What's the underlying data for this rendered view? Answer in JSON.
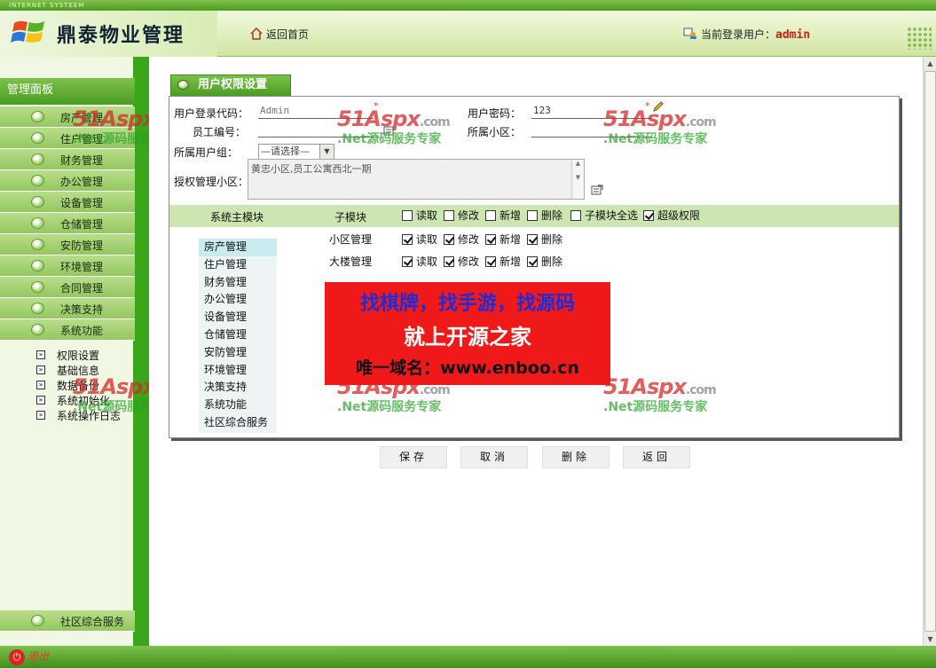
{
  "header": {
    "strip_text": "INTERNET SYSTEEM",
    "app_title": "鼎泰物业管理",
    "home_link": "返回首页",
    "login_label": "当前登录用户：",
    "login_user": "admin"
  },
  "sidebar": {
    "panel_title": "管理面板",
    "toggle": "<",
    "menu": [
      "房产管理",
      "住户管理",
      "财务管理",
      "办公管理",
      "设备管理",
      "仓储管理",
      "安防管理",
      "环境管理",
      "合同管理",
      "决策支持",
      "系统功能"
    ],
    "sub_menu": [
      "权限设置",
      "基础信息",
      "数据备份",
      "系统初始化",
      "系统操作日志"
    ],
    "bottom_item": "社区综合服务"
  },
  "bottom": {
    "logout": "退出"
  },
  "form": {
    "tab_title": "用户权限设置",
    "login_code_label": "用户登录代码：",
    "login_code_value": "Admin",
    "password_label": "用户密码：",
    "password_value": "123",
    "employee_no_label": "员工编号：",
    "community_label": "所属小区：",
    "group_label": "所属用户组：",
    "group_select": "—请选择—",
    "authorized_label": "授权管理小区：",
    "authorized_value": "黄忠小区,员工公寓西北一期",
    "required_mark": "*"
  },
  "permissions": {
    "col_main": "系统主模块",
    "col_sub": "子模块",
    "header_checks": [
      {
        "label": "读取",
        "checked": false
      },
      {
        "label": "修改",
        "checked": false
      },
      {
        "label": "新增",
        "checked": false
      },
      {
        "label": "删除",
        "checked": false
      },
      {
        "label": "子模块全选",
        "checked": false
      },
      {
        "label": "超级权限",
        "checked": true
      }
    ],
    "modules": [
      "房产管理",
      "住户管理",
      "财务管理",
      "办公管理",
      "设备管理",
      "仓储管理",
      "安防管理",
      "环境管理",
      "决策支持",
      "系统功能",
      "社区综合服务"
    ],
    "rows": [
      {
        "name": "小区管理",
        "checks": [
          "读取",
          "修改",
          "新增",
          "删除"
        ]
      },
      {
        "name": "大楼管理",
        "checks": [
          "读取",
          "修改",
          "新增",
          "删除"
        ]
      }
    ]
  },
  "ad": {
    "line1": "找棋牌，找手游，找源码",
    "line2": "就上开源之家",
    "line3": "唯一域名：www.enboo.cn"
  },
  "watermark": {
    "brand": "51Aspx",
    "suffix": ".com",
    "tagline": ".Net源码服务专家"
  },
  "buttons": {
    "save": "保存",
    "cancel": "取消",
    "delete": "删除",
    "back": "返回"
  },
  "colors": {
    "accent_green": "#4a9c22",
    "ad_red": "#f01919",
    "user_red": "#d02010"
  }
}
